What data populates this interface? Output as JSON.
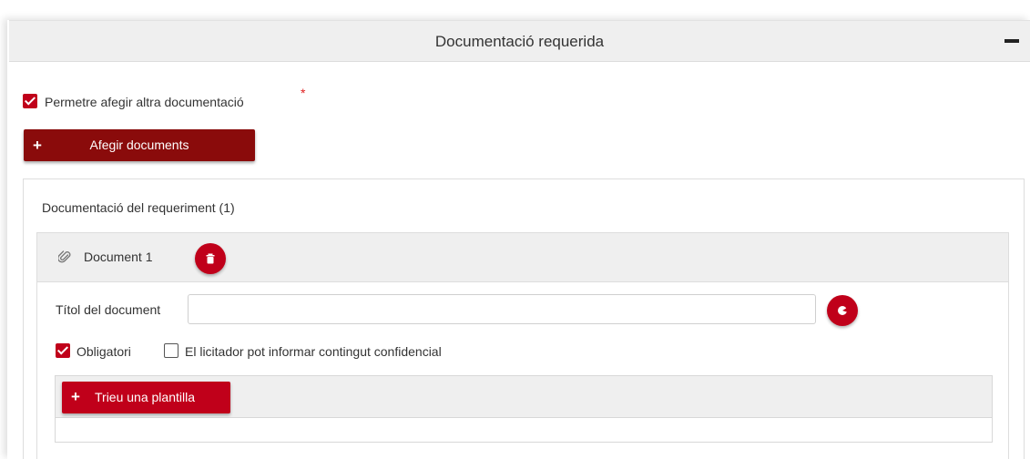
{
  "panel": {
    "title": "Documentació requerida",
    "collapse_icon": "minus-icon"
  },
  "allow_more": {
    "label": "Permetre afegir altra documentació",
    "checked": true,
    "required_mark": "*"
  },
  "add_documents_button": {
    "icon": "plus-icon",
    "label": "Afegir documents"
  },
  "requirement": {
    "title": "Documentació del requeriment (1)"
  },
  "document": {
    "icon": "paperclip-icon",
    "name": "Document 1",
    "delete_icon": "trash-icon",
    "title_label": "Títol del document",
    "title_value": "",
    "title_placeholder": "",
    "title_action_icon": "circle-icon",
    "mandatory": {
      "label": "Obligatori",
      "checked": true
    },
    "confidential": {
      "label": "El licitador pot informar contingut confidencial",
      "checked": false
    },
    "template_button": {
      "icon": "plus-icon",
      "label": "Trieu una plantilla"
    }
  },
  "colors": {
    "accent": "#c0001a",
    "accent_dark": "#8a0b0b",
    "header_bg": "#efefef",
    "required": "#e02020"
  }
}
